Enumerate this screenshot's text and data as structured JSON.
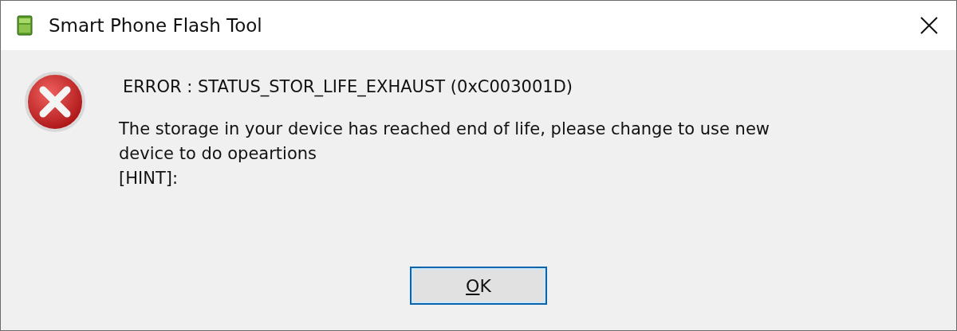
{
  "window": {
    "title": "Smart Phone Flash Tool"
  },
  "dialog": {
    "error_line": "ERROR : STATUS_STOR_LIFE_EXHAUST (0xC003001D)",
    "message_lines": [
      "The storage in your device has reached end of life, please change to use new",
      "device to do opeartions",
      "[HINT]:"
    ]
  },
  "buttons": [
    {
      "label": "OK",
      "default": true
    }
  ]
}
